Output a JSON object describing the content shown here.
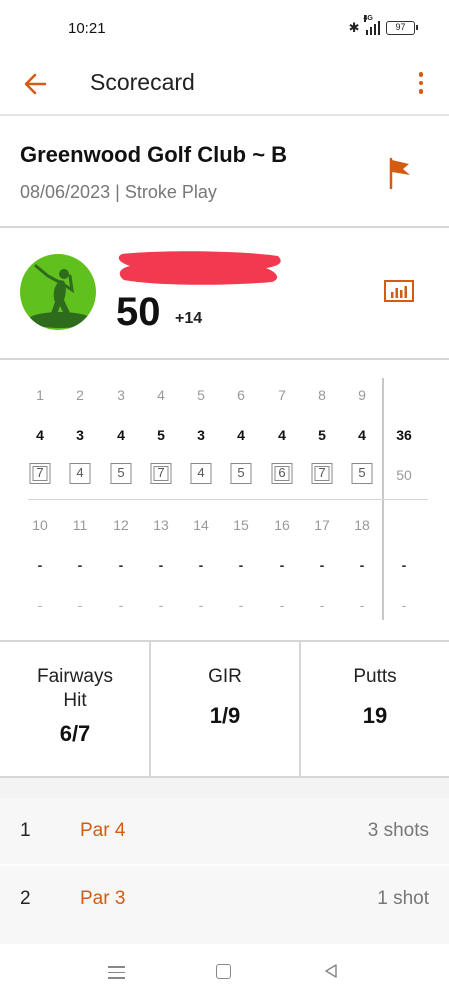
{
  "status_bar": {
    "time": "10:21",
    "network": "4G",
    "battery": "97",
    "icons": [
      "bluetooth-icon",
      "signal-icon",
      "battery-icon"
    ]
  },
  "app_bar": {
    "title": "Scorecard",
    "back_icon": "arrow-left-icon",
    "more_icon": "more-vertical-icon"
  },
  "course": {
    "name": "Greenwood Golf Club ~ B",
    "date": "08/06/2023",
    "separator": "|",
    "format": "Stroke Play",
    "icon": "flag-icon"
  },
  "player": {
    "avatar_icon": "golfer-icon",
    "name_redacted": true,
    "score": "50",
    "to_par": "+14",
    "stats_icon": "bar-chart-icon"
  },
  "scorecard": {
    "front": {
      "holes": [
        "1",
        "2",
        "3",
        "4",
        "5",
        "6",
        "7",
        "8",
        "9"
      ],
      "pars": [
        "4",
        "3",
        "4",
        "5",
        "3",
        "4",
        "4",
        "5",
        "4"
      ],
      "scores": [
        "7",
        "4",
        "5",
        "7",
        "4",
        "5",
        "6",
        "7",
        "5"
      ],
      "par_total": "36",
      "score_total": "50"
    },
    "back": {
      "holes": [
        "10",
        "11",
        "12",
        "13",
        "14",
        "15",
        "16",
        "17",
        "18"
      ],
      "pars": [
        "-",
        "-",
        "-",
        "-",
        "-",
        "-",
        "-",
        "-",
        "-"
      ],
      "scores": [
        "-",
        "-",
        "-",
        "-",
        "-",
        "-",
        "-",
        "-",
        "-"
      ],
      "par_total": "-",
      "score_total": "-"
    }
  },
  "stats": {
    "fairways": {
      "label": "Fairways Hit",
      "value": "6/7"
    },
    "gir": {
      "label": "GIR",
      "value": "1/9"
    },
    "putts": {
      "label": "Putts",
      "value": "19"
    }
  },
  "holes_list": [
    {
      "number": "1",
      "par": "Par 4",
      "shots": "3 shots"
    },
    {
      "number": "2",
      "par": "Par 3",
      "shots": "1 shot"
    }
  ],
  "nav_bar": {
    "icons": [
      "menu-icon",
      "home-icon",
      "back-triangle-icon"
    ]
  },
  "colors": {
    "accent": "#d35b12",
    "avatar_bg": "#60c11e",
    "redaction": "#f2394f"
  }
}
